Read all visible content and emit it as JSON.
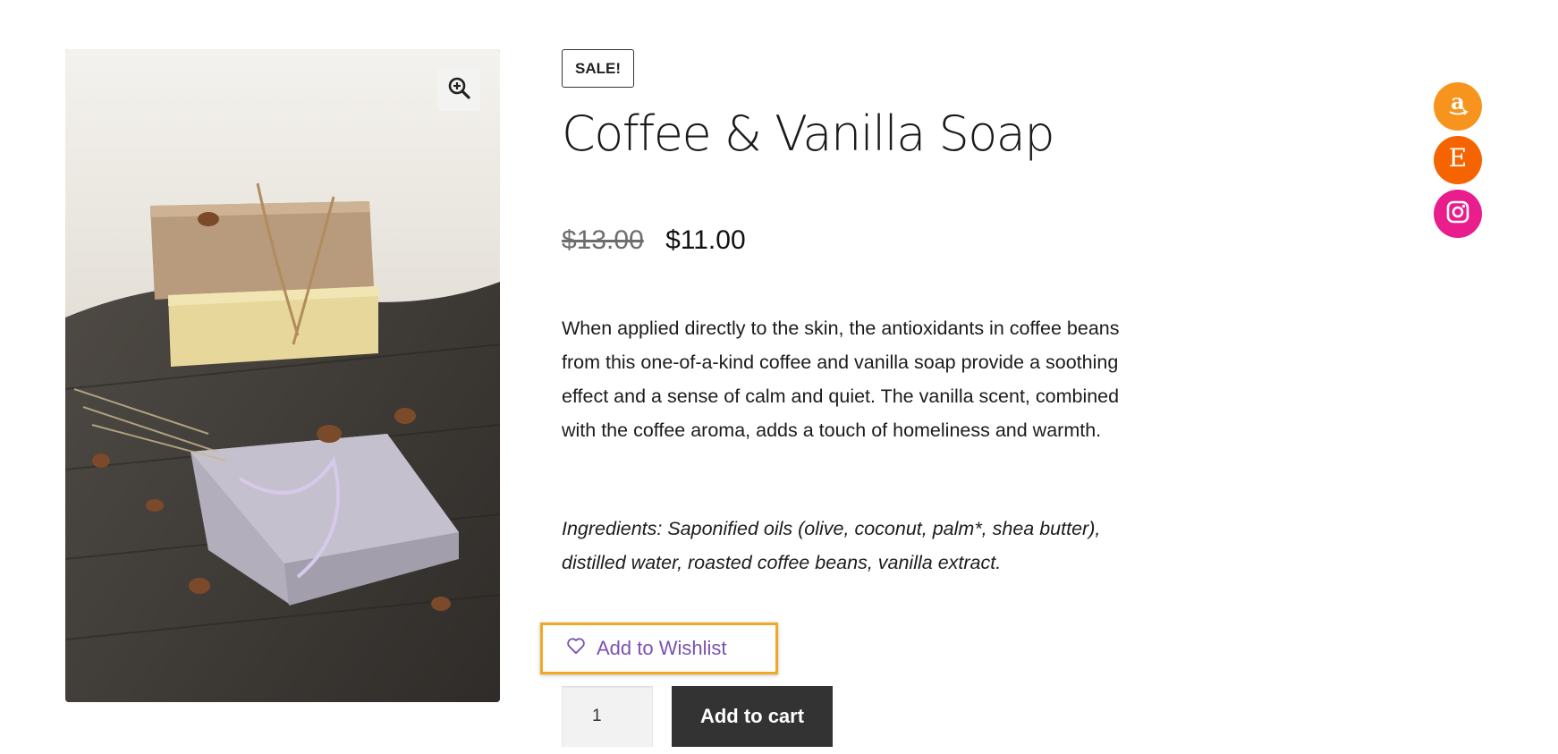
{
  "product": {
    "sale_badge": "SALE!",
    "title": "Coffee & Vanilla Soap",
    "price_old": "$13.00",
    "price_new": "$11.00",
    "description": "When applied directly to the skin, the antioxidants in coffee beans from this one-of-a-kind coffee and vanilla soap provide a soothing effect and a sense of calm and quiet. The vanilla scent, combined with the coffee aroma, adds a touch of homeliness and warmth.",
    "ingredients": "Ingredients: Saponified oils (olive, coconut, palm*, shea butter), distilled water, roasted coffee beans, vanilla extract."
  },
  "actions": {
    "wishlist_label": "Add to Wishlist",
    "quantity_value": "1",
    "add_to_cart_label": "Add to cart"
  },
  "icons": {
    "zoom": "zoom-in-icon",
    "wishlist": "heart-icon",
    "social": [
      "amazon-icon",
      "etsy-icon",
      "instagram-icon"
    ]
  },
  "colors": {
    "wishlist_text": "#7a52b3",
    "wishlist_highlight": "#f0a826",
    "add_to_cart_bg": "#333333",
    "amazon": "#f7941d",
    "etsy": "#f56400",
    "instagram": "#ea1d8c"
  }
}
